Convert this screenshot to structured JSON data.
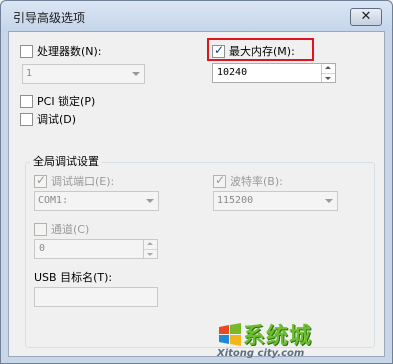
{
  "window": {
    "title": "引导高级选项",
    "close_glyph": "✕"
  },
  "processor": {
    "label": "处理器数(N):",
    "checked": false,
    "value": "1"
  },
  "max_memory": {
    "label": "最大内存(M):",
    "checked": true,
    "value": "10240"
  },
  "pci_lock": {
    "label": "PCI 锁定(P)",
    "checked": false
  },
  "debug": {
    "label": "调试(D)",
    "checked": false
  },
  "global_debug": {
    "title": "全局调试设置",
    "debug_port": {
      "label": "调试端口(E):",
      "checked": true,
      "value": "COM1:"
    },
    "baud_rate": {
      "label": "波特率(B):",
      "checked": true,
      "value": "115200"
    },
    "channel": {
      "label": "通道(C)",
      "checked": false,
      "value": "0"
    },
    "usb_target": {
      "label": "USB 目标名(T):",
      "value": ""
    }
  },
  "watermark": {
    "text": "系统城",
    "sub": "Xitong city.com"
  },
  "colors": {
    "highlight": "#e0141e",
    "watermark_green": "#6cbf2f"
  }
}
